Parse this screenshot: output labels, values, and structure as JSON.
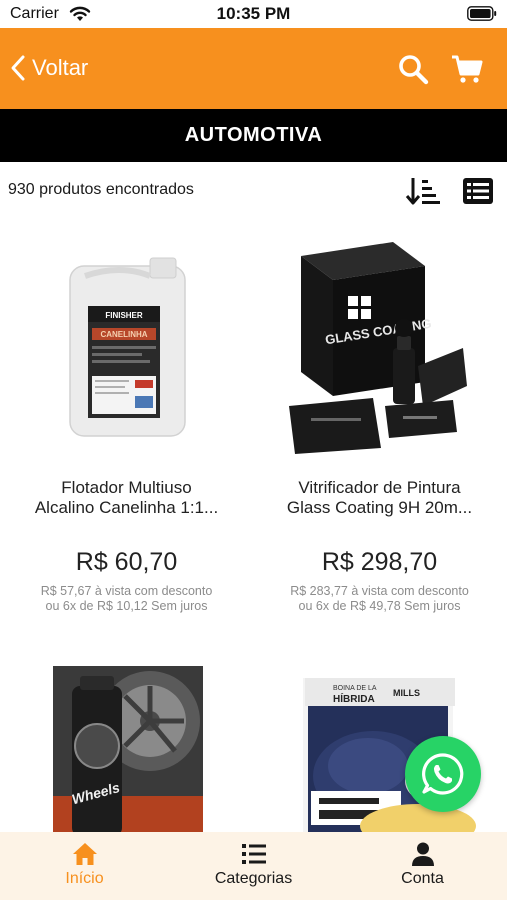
{
  "status_bar": {
    "carrier": "Carrier",
    "time": "10:35 PM"
  },
  "nav": {
    "back_label": "Voltar"
  },
  "category": {
    "title": "AUTOMOTIVA"
  },
  "toolbar": {
    "count_text": "930 produtos encontrados"
  },
  "products": [
    {
      "name_line1": "Flotador Multiuso",
      "name_line2": "Alcalino Canelinha 1:1...",
      "price": "R$ 60,70",
      "note_line1": "R$ 57,67 à vista com desconto",
      "note_line2": "ou 6x de R$ 10,12 Sem juros",
      "image_label": "CANELINHA",
      "image_brand": "FINISHER"
    },
    {
      "name_line1": "Vitrificador de Pintura",
      "name_line2": "Glass Coating 9H 20m...",
      "price": "R$ 298,70",
      "note_line1": "R$ 283,77 à vista com desconto",
      "note_line2": "ou 6x de R$ 49,78 Sem juros",
      "image_label": "GLASS COATING"
    },
    {
      "image_label": "Wheels"
    },
    {
      "image_label": "HÍBRIDA",
      "image_brand": "MILLS",
      "image_subtitle": "BOINA DE LA"
    }
  ],
  "tabs": [
    {
      "label": "Início",
      "icon": "home-icon",
      "active": true
    },
    {
      "label": "Categorias",
      "icon": "list-icon",
      "active": false
    },
    {
      "label": "Conta",
      "icon": "user-icon",
      "active": false
    }
  ],
  "colors": {
    "accent": "#f7901e",
    "whatsapp": "#27d366",
    "tabbar_bg": "#fdf3e6"
  }
}
